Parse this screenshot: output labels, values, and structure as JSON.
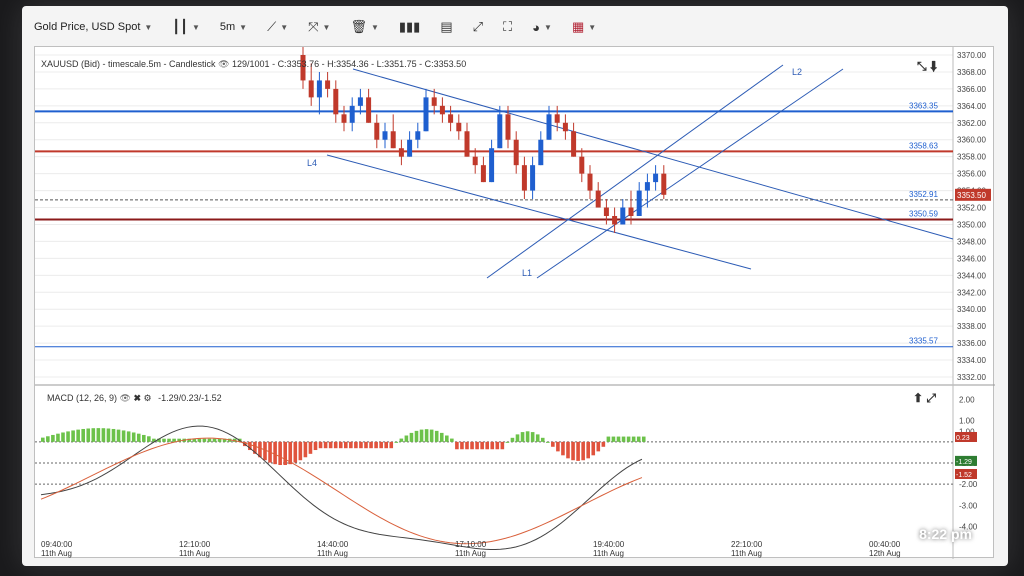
{
  "toolbar": {
    "instrument": "Gold Price, USD Spot",
    "timeframe": "5m",
    "icons": [
      "candlestick-type-icon",
      "drawing-tools-icon",
      "crosshair-tools-icon",
      "delete-icon",
      "indicators-icon",
      "layout-icon",
      "fullscreen-icon",
      "fit-icon",
      "theme-icon",
      "flag-icon"
    ]
  },
  "chart": {
    "header": "XAUUSD (Bid) - timescale.5m - Candlestick",
    "counter": "129/1001",
    "ohlc": "C:3353.76 - H:3354.36 - L:3351.75 - C:3353.50",
    "price_ticks": [
      "3370.00",
      "3368.00",
      "3366.00",
      "3364.00",
      "3362.00",
      "3360.00",
      "3358.00",
      "3356.00",
      "3354.00",
      "3352.00",
      "3350.00",
      "3348.00",
      "3346.00",
      "3344.00",
      "3342.00",
      "3340.00",
      "3338.00",
      "3336.00",
      "3334.00",
      "3332.00"
    ],
    "current_price": "3353.50",
    "current_price_color": "#c0392b",
    "levels": [
      {
        "value": 3363.35,
        "label": "3363.35",
        "color": "#1f5fcf",
        "width": 2
      },
      {
        "value": 3358.63,
        "label": "3358.63",
        "color": "#c0392b",
        "width": 2
      },
      {
        "value": 3352.91,
        "label": "3352.91",
        "color": "#555555",
        "width": 1,
        "dashed": true
      },
      {
        "value": 3350.59,
        "label": "3350.59",
        "color": "#8b1a1a",
        "width": 2
      },
      {
        "value": 3335.57,
        "label": "3335.57",
        "color": "#1f5fcf",
        "width": 1
      }
    ],
    "line_labels": [
      "L1",
      "L2",
      "L4"
    ],
    "time_ticks": [
      {
        "time": "09:40:00",
        "date": "11th Aug"
      },
      {
        "time": "12:10:00",
        "date": "11th Aug"
      },
      {
        "time": "14:40:00",
        "date": "11th Aug"
      },
      {
        "time": "17:10:00",
        "date": "11th Aug"
      },
      {
        "time": "19:40:00",
        "date": "11th Aug"
      },
      {
        "time": "22:10:00",
        "date": "11th Aug"
      },
      {
        "time": "00:40:00",
        "date": "12th Aug"
      }
    ]
  },
  "macd": {
    "title": "MACD (12, 26, 9)",
    "values": "-1.29/0.23/-1.52",
    "ticks": [
      "2.00",
      "1.00",
      "1.00",
      "-1.00",
      "-2.00",
      "-3.00",
      "-4.00"
    ],
    "signal_label": "0.23",
    "macd_label": "-1.29",
    "hist_label": "-1.52"
  },
  "status": {
    "clock": "8:22 pm"
  }
}
